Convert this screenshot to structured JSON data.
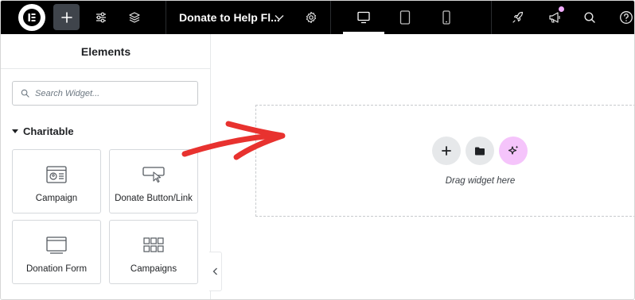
{
  "toolbar": {
    "add_element": "plus-icon",
    "site_settings": "sliders-icon",
    "structure": "layers-icon",
    "document_title": "Donate to Help Fl...",
    "document_menu": "chevron-down-icon",
    "page_settings": "gear-icon",
    "devices": [
      "desktop-icon",
      "tablet-icon",
      "mobile-icon"
    ],
    "active_device": "desktop",
    "publish_tools": "rocket-icon",
    "notifications": "megaphone-icon",
    "notification_badge_color": "#f0abfc",
    "search": "search-icon",
    "help": "help-icon"
  },
  "panel": {
    "title": "Elements",
    "search_placeholder": "Search Widget...",
    "category": "Charitable",
    "widgets": [
      {
        "label": "Campaign",
        "icon": "campaign-icon"
      },
      {
        "label": "Donate Button/Link",
        "icon": "donate-button-icon"
      },
      {
        "label": "Donation Form",
        "icon": "donation-form-icon"
      },
      {
        "label": "Campaigns",
        "icon": "campaigns-grid-icon"
      }
    ]
  },
  "canvas": {
    "drop_text": "Drag widget here",
    "buttons": [
      "add-section-icon",
      "template-library-icon",
      "ai-sparkle-icon"
    ],
    "ai_button_color": "#f5c4fb",
    "annotation_arrow_color": "#e8322f"
  }
}
